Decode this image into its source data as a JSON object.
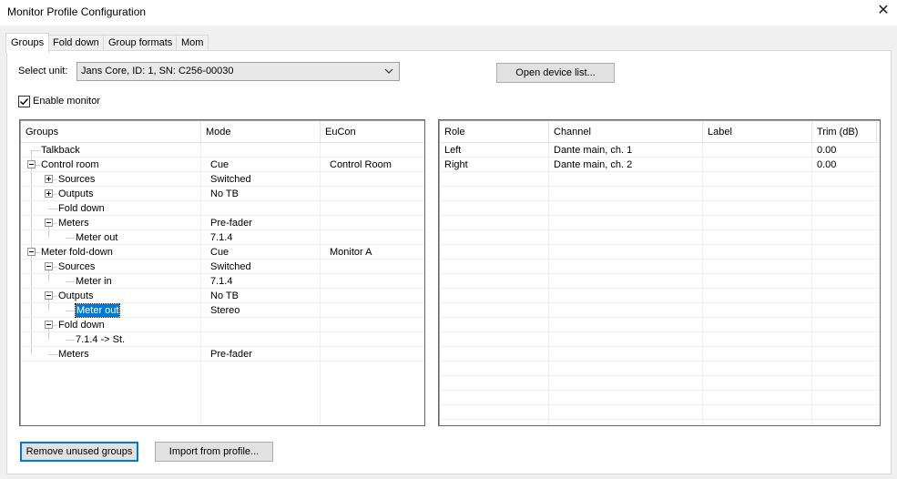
{
  "window": {
    "title": "Monitor Profile Configuration",
    "close_glyph": "✕"
  },
  "tabs": [
    {
      "label": "Groups",
      "active": true
    },
    {
      "label": "Fold down",
      "active": false
    },
    {
      "label": "Group formats",
      "active": false
    },
    {
      "label": "Mom",
      "active": false
    }
  ],
  "unit": {
    "label": "Select unit:",
    "value": "Jans Core, ID: 1, SN: C256-00030"
  },
  "open_device_list_label": "Open device list...",
  "enable_monitor": {
    "label": "Enable monitor",
    "checked": true
  },
  "groups_table": {
    "columns": [
      "Groups",
      "Mode",
      "EuCon"
    ],
    "rows": [
      {
        "name": "Talkback",
        "mode": "",
        "eucon": "",
        "level": 0,
        "expander": "none"
      },
      {
        "name": "Control room",
        "mode": "Cue",
        "eucon": "Control Room",
        "level": 0,
        "expander": "minus"
      },
      {
        "name": "Sources",
        "mode": "Switched",
        "eucon": "",
        "level": 1,
        "expander": "plus"
      },
      {
        "name": "Outputs",
        "mode": "No TB",
        "eucon": "",
        "level": 1,
        "expander": "plus"
      },
      {
        "name": "Fold down",
        "mode": "",
        "eucon": "",
        "level": 1,
        "expander": "none"
      },
      {
        "name": "Meters",
        "mode": "Pre-fader",
        "eucon": "",
        "level": 1,
        "expander": "minus"
      },
      {
        "name": "Meter out",
        "mode": "7.1.4",
        "eucon": "",
        "level": 2,
        "expander": "none"
      },
      {
        "name": "Meter fold-down",
        "mode": "Cue",
        "eucon": "Monitor A",
        "level": 0,
        "expander": "minus"
      },
      {
        "name": "Sources",
        "mode": "Switched",
        "eucon": "",
        "level": 1,
        "expander": "minus"
      },
      {
        "name": "Meter in",
        "mode": "7.1.4",
        "eucon": "",
        "level": 2,
        "expander": "none"
      },
      {
        "name": "Outputs",
        "mode": "No TB",
        "eucon": "",
        "level": 1,
        "expander": "minus"
      },
      {
        "name": "Meter out",
        "mode": "Stereo",
        "eucon": "",
        "level": 2,
        "expander": "none",
        "selected": true
      },
      {
        "name": "Fold down",
        "mode": "",
        "eucon": "",
        "level": 1,
        "expander": "minus"
      },
      {
        "name": "7.1.4 -> St.",
        "mode": "",
        "eucon": "",
        "level": 2,
        "expander": "none"
      },
      {
        "name": "Meters",
        "mode": "Pre-fader",
        "eucon": "",
        "level": 1,
        "expander": "none"
      }
    ]
  },
  "channels_table": {
    "columns": [
      "Role",
      "Channel",
      "Label",
      "Trim (dB)"
    ],
    "rows": [
      {
        "role": "Left",
        "channel": "Dante main, ch. 1",
        "label": "",
        "trim": "0.00"
      },
      {
        "role": "Right",
        "channel": "Dante main, ch. 2",
        "label": "",
        "trim": "0.00"
      }
    ]
  },
  "remove_unused_label": "Remove unused groups",
  "import_profile_label": "Import from profile..."
}
